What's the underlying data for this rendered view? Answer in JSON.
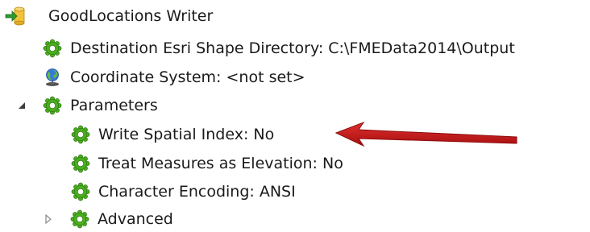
{
  "tree": {
    "writer": {
      "label": "GoodLocations Writer",
      "icon": "writer-icon"
    },
    "destination": {
      "label": "Destination Esri Shape Directory: C:\\FMEData2014\\Output",
      "icon": "gear-icon"
    },
    "coordinate_system": {
      "label": "Coordinate System: <not set>",
      "icon": "globe-icon"
    },
    "parameters": {
      "label": "Parameters",
      "icon": "gear-icon",
      "expanded": true,
      "children": [
        {
          "label": "Write Spatial Index: No",
          "icon": "gear-icon"
        },
        {
          "label": "Treat Measures as Elevation: No",
          "icon": "gear-icon"
        },
        {
          "label": "Character Encoding: ANSI",
          "icon": "gear-icon"
        }
      ]
    },
    "advanced": {
      "label": "Advanced",
      "icon": "gear-icon",
      "expanded": false
    }
  },
  "colors": {
    "gear": "#4caf1f",
    "gear_dark": "#2e7d12",
    "arrow": "#cc1a1a",
    "cylinder": "#f2c23a",
    "writer_arrow": "#2e9c2e"
  }
}
